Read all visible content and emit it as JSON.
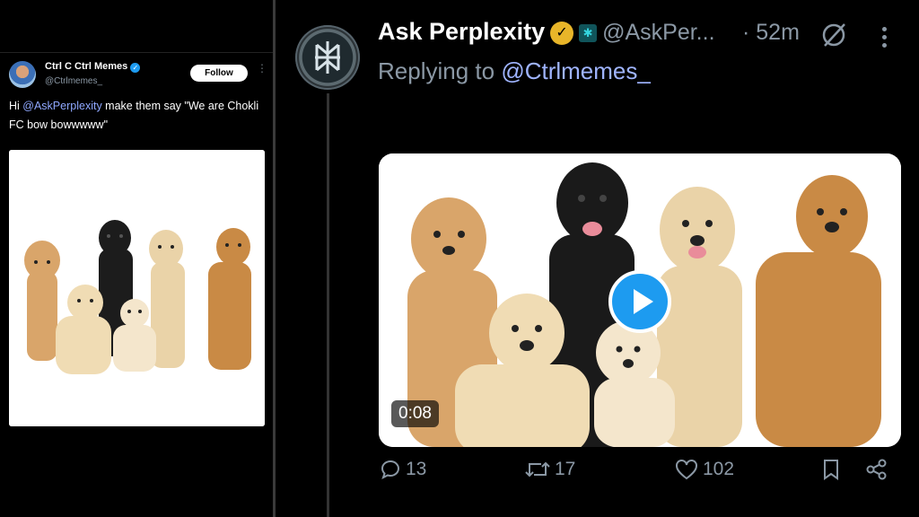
{
  "left_tweet": {
    "author_name": "Ctrl C Ctrl Memes",
    "author_handle": "@Ctrlmemes_",
    "follow_label": "Follow",
    "text_prefix": "Hi ",
    "mention": "@AskPerplexity",
    "text_suffix": " make them say \"We are Chokli FC bow bowwwww\""
  },
  "right_tweet": {
    "author_name": "Ask Perplexity",
    "author_handle": "@AskPer...",
    "time_sep": "·",
    "time": "52m",
    "replying_label": "Replying to ",
    "replying_to": "@Ctrlmemes_",
    "video_duration": "0:08",
    "counts": {
      "replies": "13",
      "reposts": "17",
      "likes": "102"
    }
  },
  "icons": [
    "verified-icon",
    "gold-verified-icon",
    "org-badge-icon",
    "perplexity-logo-icon",
    "more-icon",
    "reply-icon",
    "repost-icon",
    "like-icon",
    "bookmark-icon",
    "share-icon",
    "play-icon"
  ],
  "colors": {
    "accent": "#1d9bf0",
    "mention": "#8fa8ff",
    "gold_badge": "#e8b529"
  }
}
